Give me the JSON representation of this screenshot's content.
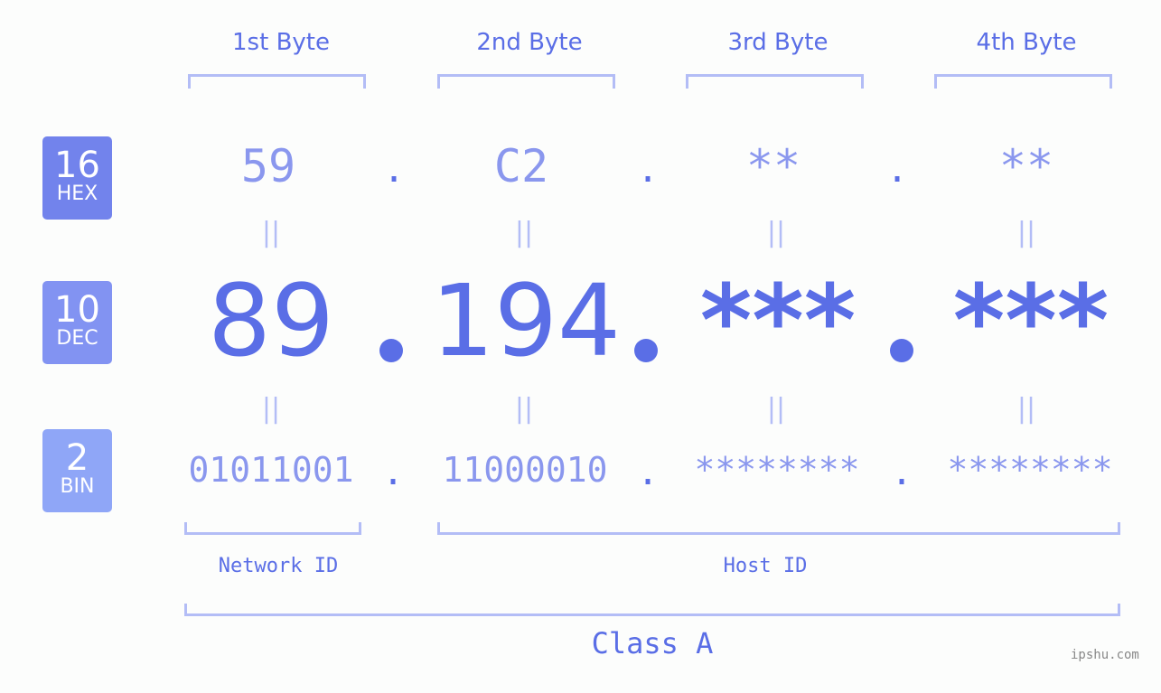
{
  "bases": [
    {
      "number": "16",
      "label": "HEX",
      "color": "#7283ec"
    },
    {
      "number": "10",
      "label": "DEC",
      "color": "#8293f2"
    },
    {
      "number": "2",
      "label": "BIN",
      "color": "#8fa6f7"
    }
  ],
  "byte_headers": [
    "1st Byte",
    "2nd Byte",
    "3rd Byte",
    "4th Byte"
  ],
  "hex": [
    "59",
    "C2",
    "**",
    "**"
  ],
  "dec": [
    "89",
    "194",
    "***",
    "***"
  ],
  "bin": [
    "01011001",
    "11000010",
    "********",
    "********"
  ],
  "separator": ".",
  "equals": "||",
  "network_label": "Network ID",
  "host_label": "Host ID",
  "class_label": "Class A",
  "watermark": "ipshu.com"
}
